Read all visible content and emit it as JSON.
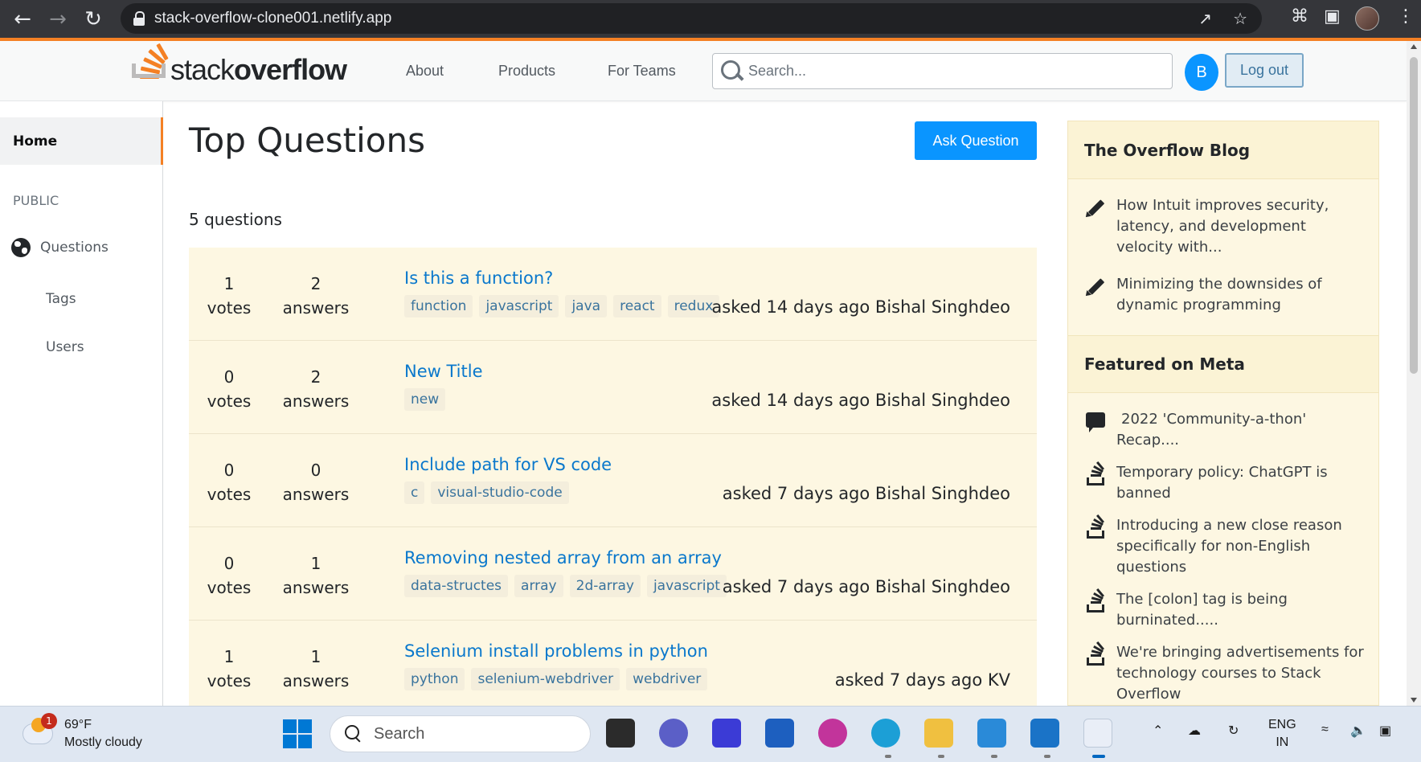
{
  "browser": {
    "url": "stack-overflow-clone001.netlify.app"
  },
  "header": {
    "logo_text_light": "stack",
    "logo_text_bold": "overflow",
    "nav": [
      "About",
      "Products",
      "For Teams"
    ],
    "search_placeholder": "Search...",
    "user_initial": "B",
    "logout_label": "Log out"
  },
  "sidebar": {
    "home": "Home",
    "section": "PUBLIC",
    "questions": "Questions",
    "tags": "Tags",
    "users": "Users"
  },
  "main": {
    "title": "Top Questions",
    "ask_button": "Ask Question",
    "count_text": "5 questions",
    "questions": [
      {
        "votes": "1",
        "votes_label": "votes",
        "answers": "2",
        "answers_label": "answers",
        "title": "Is this a function?",
        "tags": [
          "function",
          "javascript",
          "java",
          "react",
          "redux"
        ],
        "asked": "asked 14 days ago Bishal Singhdeo"
      },
      {
        "votes": "0",
        "votes_label": "votes",
        "answers": "2",
        "answers_label": "answers",
        "title": "New Title",
        "tags": [
          "new"
        ],
        "asked": "asked 14 days ago Bishal Singhdeo"
      },
      {
        "votes": "0",
        "votes_label": "votes",
        "answers": "0",
        "answers_label": "answers",
        "title": "Include path for VS code",
        "tags": [
          "c",
          "visual-studio-code"
        ],
        "asked": "asked 7 days ago Bishal Singhdeo"
      },
      {
        "votes": "0",
        "votes_label": "votes",
        "answers": "1",
        "answers_label": "answers",
        "title": "Removing nested array from an array",
        "tags": [
          "data-structes",
          "array",
          "2d-array",
          "javascript"
        ],
        "asked": "asked 7 days ago Bishal Singhdeo"
      },
      {
        "votes": "1",
        "votes_label": "votes",
        "answers": "1",
        "answers_label": "answers",
        "title": "Selenium install problems in python",
        "tags": [
          "python",
          "selenium-webdriver",
          "webdriver"
        ],
        "asked": "asked 7 days ago KV"
      }
    ]
  },
  "rightbar": {
    "blog_heading": "The Overflow Blog",
    "blog_items": [
      "How Intuit improves security, latency, and development velocity with...",
      "Minimizing the downsides of dynamic programming"
    ],
    "meta_heading": "Featured on Meta",
    "meta_items": [
      {
        "icon": "chat-bubble-icon",
        "text": "2022 'Community-a-thon' Recap...."
      },
      {
        "icon": "stack-overflow-icon",
        "text": "Temporary policy: ChatGPT is banned"
      },
      {
        "icon": "stack-overflow-icon",
        "text": "Introducing a new close reason specifically for non-English questions"
      },
      {
        "icon": "stack-overflow-icon",
        "text": "The [colon] tag is being burninated....."
      },
      {
        "icon": "stack-overflow-icon",
        "text": "We're bringing advertisements for technology courses to Stack Overflow"
      }
    ]
  },
  "taskbar": {
    "weather_temp": "69°F",
    "weather_desc": "Mostly cloudy",
    "weather_badge": "1",
    "search_label": "Search",
    "lang_line1": "ENG",
    "lang_line2": "IN"
  },
  "colors": {
    "accent": "#f48024",
    "primary": "#0a95ff",
    "link": "#0a78cc",
    "row_bg": "#fdf7e2"
  }
}
